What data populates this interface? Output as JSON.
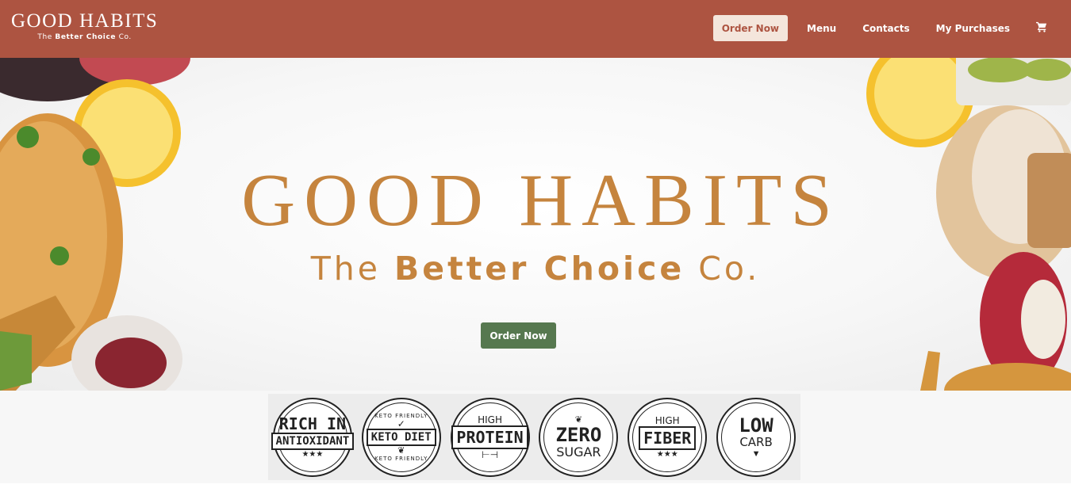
{
  "header": {
    "logo_title": "GOOD HABITS",
    "logo_sub_prefix": "The",
    "logo_sub_bold": "Better Choice",
    "logo_sub_suffix": "Co.",
    "nav": {
      "order_now": "Order Now",
      "menu": "Menu",
      "contacts": "Contacts",
      "my_purchases": "My Purchases"
    },
    "cart_icon": "cart-icon"
  },
  "hero": {
    "title": "GOOD HABITS",
    "sub_prefix": "The",
    "sub_bold": "Better Choice",
    "sub_suffix": "Co.",
    "cta": "Order Now"
  },
  "badges": [
    {
      "top": "RICH IN",
      "ribbon": "ANTIOXIDANT",
      "stars": "★★★"
    },
    {
      "arc_top": "KETO FRIENDLY",
      "ribbon": "KETO DIET",
      "arc_bottom": "KETO FRIENDLY"
    },
    {
      "top": "HIGH",
      "ribbon": "PROTEIN"
    },
    {
      "top": "ZERO",
      "bottom": "SUGAR"
    },
    {
      "top": "HIGH",
      "ribbon": "FIBER",
      "stars": "★★★"
    },
    {
      "top": "LOW",
      "bottom": "CARB"
    }
  ],
  "colors": {
    "header_bg": "#ad5441",
    "hero_text": "#c5843e",
    "cta_bg": "#56784f"
  }
}
